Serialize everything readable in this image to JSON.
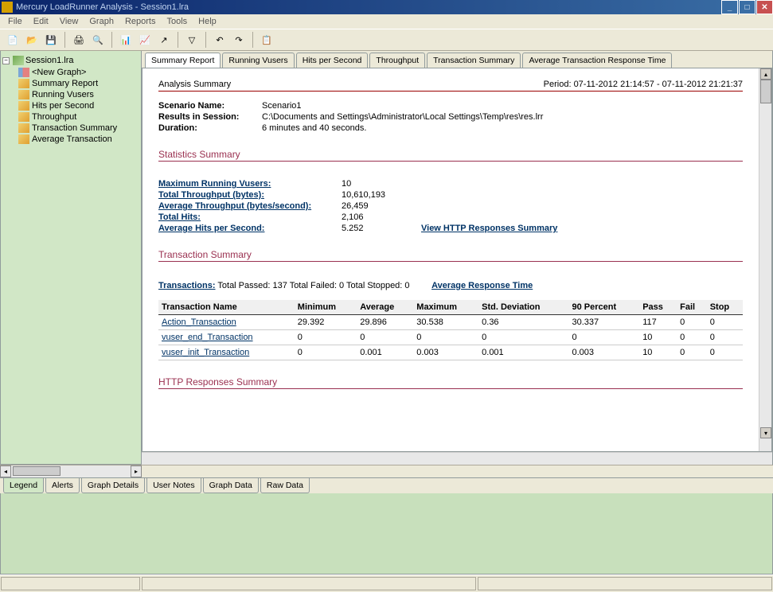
{
  "window": {
    "title": "Mercury LoadRunner Analysis - Session1.lra"
  },
  "menu": [
    "File",
    "Edit",
    "View",
    "Graph",
    "Reports",
    "Tools",
    "Help"
  ],
  "tree": {
    "root": "Session1.lra",
    "items": [
      "<New Graph>",
      "Summary Report",
      "Running Vusers",
      "Hits per Second",
      "Throughput",
      "Transaction Summary",
      "Average Transaction"
    ]
  },
  "tabs": [
    "Summary Report",
    "Running Vusers",
    "Hits per Second",
    "Throughput",
    "Transaction Summary",
    "Average Transaction Response Time"
  ],
  "summary": {
    "title": "Analysis Summary",
    "period": "Period: 07-11-2012 21:14:57 - 07-11-2012 21:21:37",
    "scenario_label": "Scenario Name:",
    "scenario": "Scenario1",
    "results_label": "Results in Session:",
    "results": "C:\\Documents and Settings\\Administrator\\Local Settings\\Temp\\res\\res.lrr",
    "duration_label": "Duration:",
    "duration": "6 minutes and 40 seconds."
  },
  "stats": {
    "heading": "Statistics Summary",
    "rows": [
      {
        "label": "Maximum Running Vusers:",
        "value": "10",
        "link": ""
      },
      {
        "label": "Total Throughput (bytes):",
        "value": "10,610,193",
        "link": ""
      },
      {
        "label": "Average Throughput (bytes/second):",
        "value": "26,459",
        "link": ""
      },
      {
        "label": "Total Hits:",
        "value": "2,106",
        "link": ""
      },
      {
        "label": "Average Hits per Second:",
        "value": "5.252",
        "link": "View HTTP Responses Summary"
      }
    ]
  },
  "trans": {
    "heading": "Transaction Summary",
    "line_label": "Transactions:",
    "line_text": " Total Passed: 137 Total Failed: 0 Total Stopped: 0",
    "line_link": "Average Response Time",
    "cols": [
      "Transaction Name",
      "Minimum",
      "Average",
      "Maximum",
      "Std. Deviation",
      "90 Percent",
      "Pass",
      "Fail",
      "Stop"
    ],
    "rows": [
      {
        "name": "Action_Transaction",
        "min": "29.392",
        "avg": "29.896",
        "max": "30.538",
        "std": "0.36",
        "p90": "30.337",
        "pass": "117",
        "fail": "0",
        "stop": "0"
      },
      {
        "name": "vuser_end_Transaction",
        "min": "0",
        "avg": "0",
        "max": "0",
        "std": "0",
        "p90": "0",
        "pass": "10",
        "fail": "0",
        "stop": "0"
      },
      {
        "name": "vuser_init_Transaction",
        "min": "0",
        "avg": "0.001",
        "max": "0.003",
        "std": "0.001",
        "p90": "0.003",
        "pass": "10",
        "fail": "0",
        "stop": "0"
      }
    ]
  },
  "http": {
    "heading": "HTTP Responses Summary"
  },
  "btabs": [
    "Legend",
    "Alerts",
    "Graph Details",
    "User Notes",
    "Graph Data",
    "Raw Data"
  ]
}
